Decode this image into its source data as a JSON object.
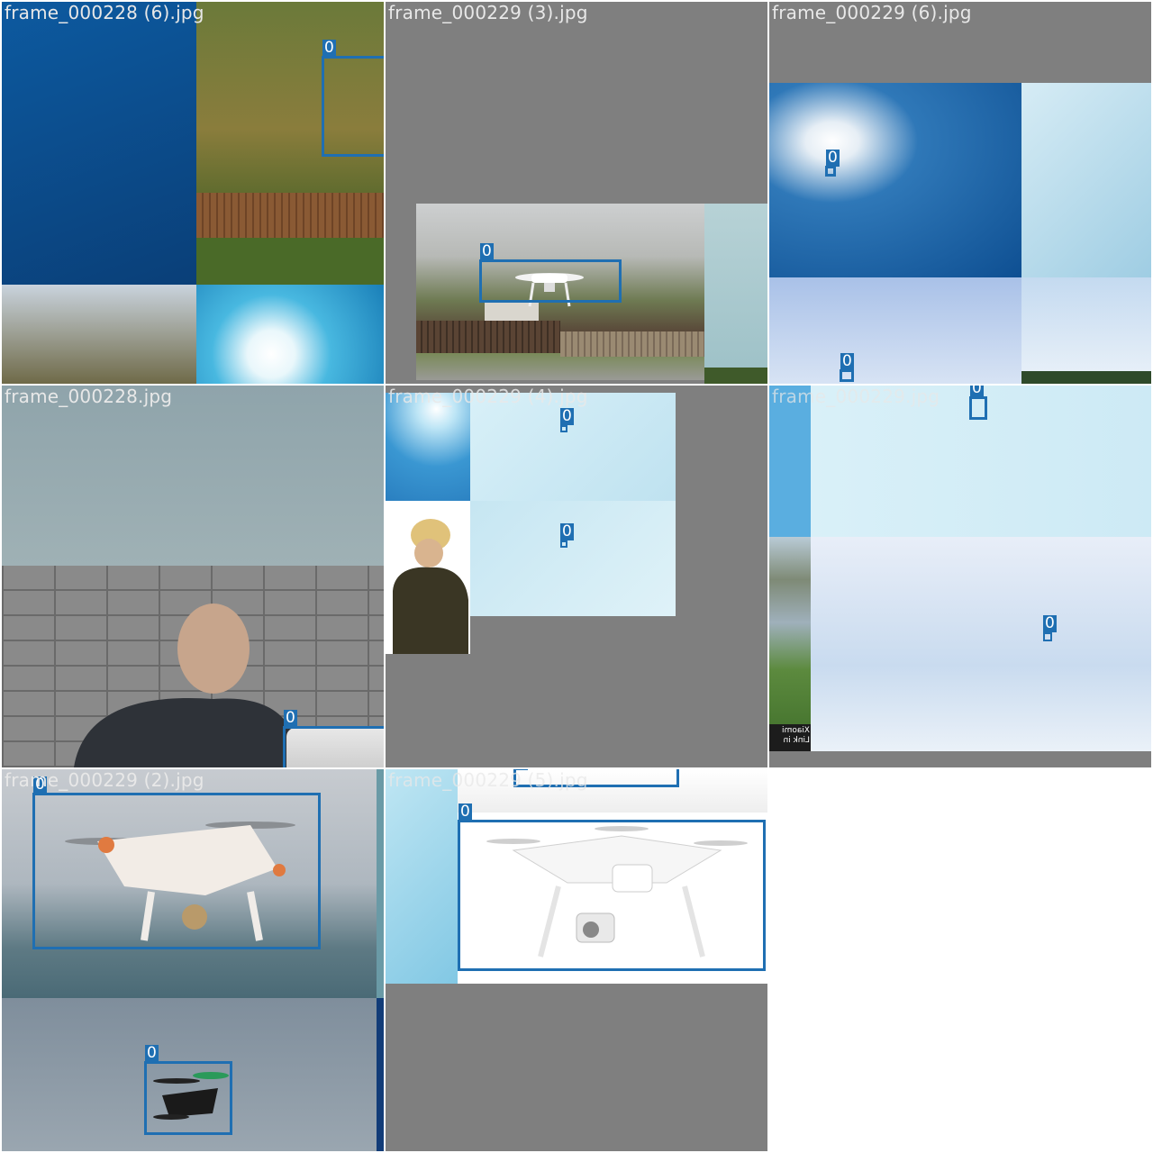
{
  "tiles": [
    {
      "filename": "frame_000228 (6).jpg"
    },
    {
      "filename": "frame_000229 (3).jpg"
    },
    {
      "filename": "frame_000229 (6).jpg"
    },
    {
      "filename": "frame_000228.jpg"
    },
    {
      "filename": "frame_000229 (4).jpg"
    },
    {
      "filename": "frame_000229.jpg"
    },
    {
      "filename": "frame_000229 (2).jpg"
    },
    {
      "filename": "frame_000229 (5).jpg"
    }
  ],
  "class_label": "0",
  "caption_text": "Xiaomi Link in",
  "colors": {
    "box": "#1f6fb2",
    "padding": "#7f7f7f",
    "background": "#ffffff"
  }
}
